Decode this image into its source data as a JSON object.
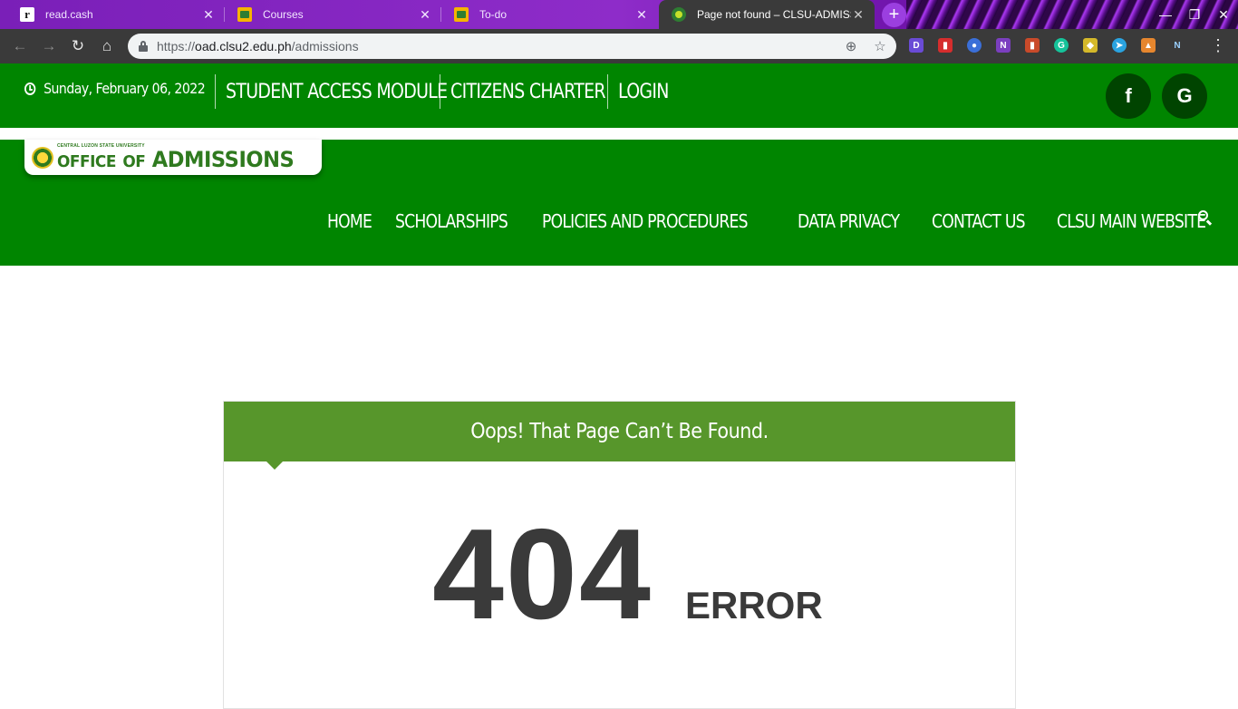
{
  "browser": {
    "tabs": [
      {
        "title": "read.cash",
        "favicon": "r"
      },
      {
        "title": "Courses",
        "favicon": ""
      },
      {
        "title": "To-do",
        "favicon": ""
      },
      {
        "title": "Page not found – CLSU-ADMISSIONS",
        "favicon": ""
      }
    ],
    "new_tab": "+",
    "url_prefix": "https://",
    "url_host": "oad.clsu2.edu.ph",
    "url_path": "/admissions",
    "colors": {
      "tabbar": "#8e2cc9",
      "toolbar": "#3a3a3a"
    }
  },
  "topbar": {
    "date": "Sunday, February 06, 2022",
    "links": [
      "STUDENT ACCESS MODULE",
      "CITIZENS CHARTER",
      "LOGIN"
    ],
    "social": [
      {
        "icon": "facebook-icon",
        "glyph": "f"
      },
      {
        "icon": "google-icon",
        "glyph": "G"
      }
    ]
  },
  "logo": {
    "small_text": "CENTRAL LUZON STATE UNIVERSITY",
    "office": "OFFICE",
    "of": "OF",
    "admissions": "ADMISSIONS"
  },
  "nav": {
    "items": [
      "HOME",
      "SCHOLARSHIPS",
      "POLICIES AND PROCEDURES",
      "DATA PRIVACY",
      "CONTACT US",
      "CLSU MAIN WEBSITE"
    ]
  },
  "error": {
    "heading": "Oops! That Page Can’t Be Found.",
    "code": "404",
    "word": "ERROR"
  },
  "colors": {
    "brand_green": "#008500",
    "error_head": "#57962b",
    "text_dark": "#3a3a3a"
  }
}
